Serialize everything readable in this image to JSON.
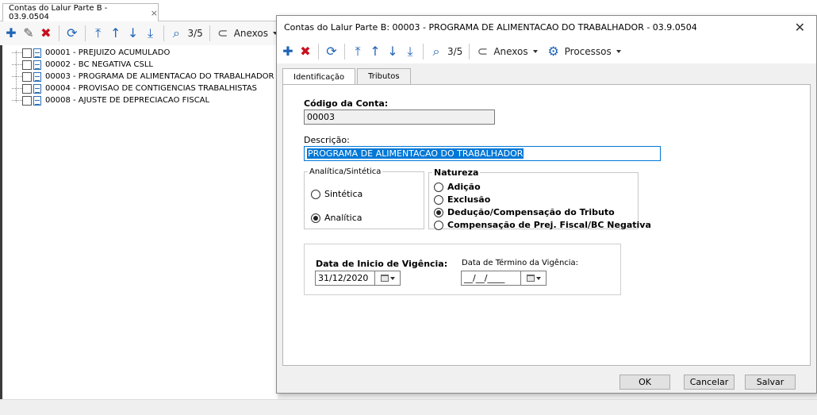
{
  "main": {
    "tab_label": "Contas do Lalur Parte B - 03.9.0504",
    "tab_close": "×",
    "toolbar": {
      "counter": "3/5",
      "anexos": "Anexos"
    },
    "tree": [
      "00001 - PREJUIZO ACUMULADO",
      "00002 - BC NEGATIVA CSLL",
      "00003 - PROGRAMA DE ALIMENTACAO DO TRABALHADOR",
      "00004 - PROVISAO DE CONTIGENCIAS TRABALHISTAS",
      "00008 - AJUSTE DE DEPRECIACAO FISCAL"
    ]
  },
  "dialog": {
    "title": "Contas do Lalur Parte B: 00003 - PROGRAMA DE ALIMENTACAO DO TRABALHADOR - 03.9.0504",
    "close": "✕",
    "toolbar": {
      "counter": "3/5",
      "anexos": "Anexos",
      "processos": "Processos"
    },
    "tabs": [
      "Identificação",
      "Tributos"
    ],
    "codigo_label": "Código da Conta:",
    "codigo_value": "00003",
    "descricao_label": "Descrição:",
    "descricao_value": "PROGRAMA DE ALIMENTACAO DO TRABALHADOR",
    "analitica": {
      "legend": "Analítica/Sintética",
      "options": [
        "Sintética",
        "Analítica"
      ],
      "selected": "Analítica"
    },
    "natureza": {
      "legend": "Natureza",
      "options": [
        "Adição",
        "Exclusão",
        "Dedução/Compensação do Tributo",
        "Compensação de Prej. Fiscal/BC Negativa"
      ],
      "selected": "Dedução/Compensação do Tributo"
    },
    "vigencia": {
      "inicio_label": "Data de Inicio de Vigência:",
      "inicio_value": "31/12/2020",
      "termino_label": "Data de Término da Vigência:",
      "termino_value": "__/__/____"
    },
    "buttons": {
      "ok": "OK",
      "cancelar": "Cancelar",
      "salvar": "Salvar"
    }
  },
  "colors": {
    "accent": "#1f63b7",
    "delete": "#c8101e",
    "selection": "#0078d7"
  },
  "icons": [
    "plus-icon",
    "edit-icon",
    "delete-icon",
    "refresh-icon",
    "first-icon",
    "up-icon",
    "down-icon",
    "last-icon",
    "search-icon",
    "attachment-icon",
    "gear-icon",
    "calendar-icon"
  ]
}
